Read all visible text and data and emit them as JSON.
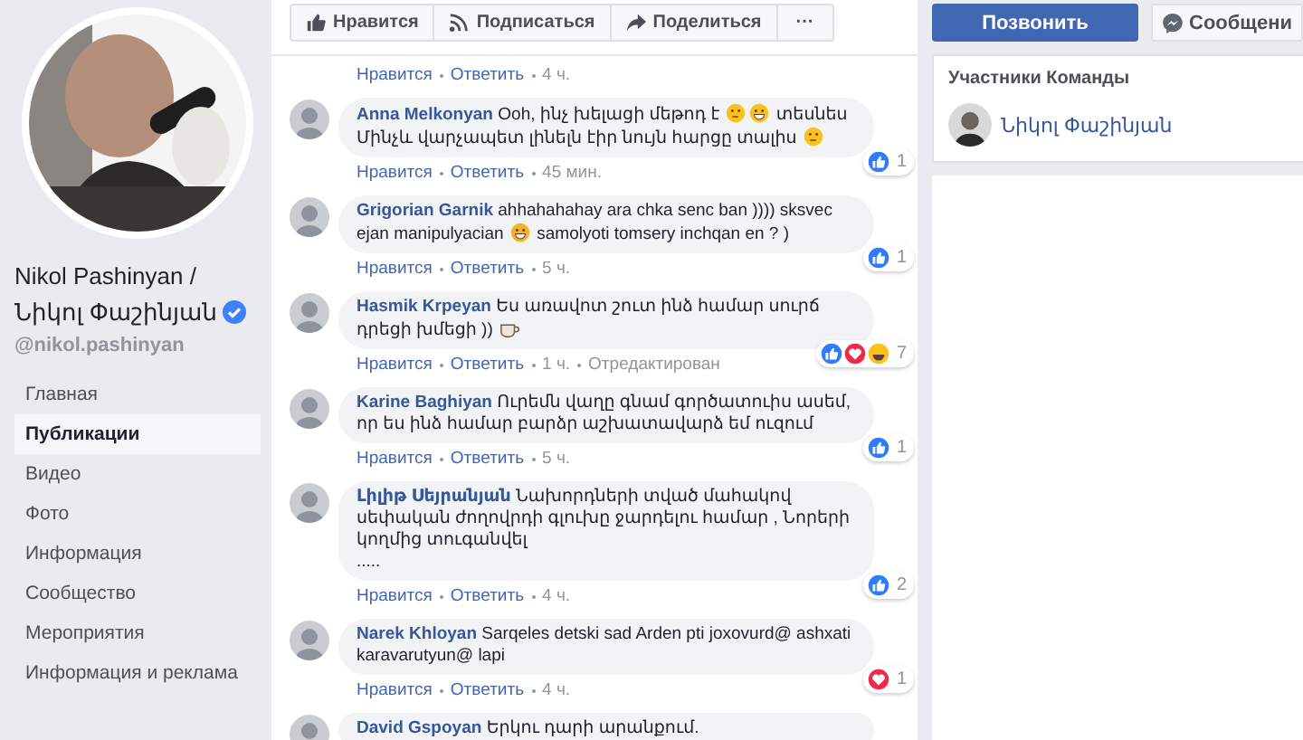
{
  "profile": {
    "name": "Nikol Pashinyan / Նիկոլ Փաշինյան",
    "verified": true,
    "handle": "@nikol.pashinyan"
  },
  "nav": [
    {
      "label": "Главная",
      "selected": false
    },
    {
      "label": "Публикации",
      "selected": true
    },
    {
      "label": "Видео",
      "selected": false
    },
    {
      "label": "Фото",
      "selected": false
    },
    {
      "label": "Информация",
      "selected": false
    },
    {
      "label": "Сообщество",
      "selected": false
    },
    {
      "label": "Мероприятия",
      "selected": false
    },
    {
      "label": "Информация и реклама",
      "selected": false
    }
  ],
  "actions": [
    {
      "kind": "like",
      "label": "Нравится"
    },
    {
      "kind": "follow",
      "label": "Подписаться"
    },
    {
      "kind": "share",
      "label": "Поделиться"
    },
    {
      "kind": "more",
      "label": "···"
    }
  ],
  "previous_meta": {
    "like": "Нравится",
    "reply": "Ответить",
    "time": "4 ч."
  },
  "comments": [
    {
      "author": "Anna Melkonyan",
      "parts": [
        {
          "kind": "text",
          "text": "Ooh, ինչ խելացի մեթոդ է "
        },
        {
          "kind": "thinking"
        },
        {
          "kind": "grin"
        },
        {
          "kind": "text",
          "text": " տեսնես Մինչև վարչապետ լինելն էիր նույն հարցը տալիս "
        },
        {
          "kind": "thinking"
        }
      ],
      "reactions": [
        {
          "kind": "like"
        }
      ],
      "count": "1",
      "meta": {
        "like": "Нравится",
        "reply": "Ответить",
        "time": "45 мин."
      }
    },
    {
      "author": "Grigorian Garnik",
      "parts": [
        {
          "kind": "text",
          "text": "ahhahahahay ara chka senc ban )))) sksvec ejan manipulyacian "
        },
        {
          "kind": "laugh"
        },
        {
          "kind": "text",
          "text": " samolyoti tomsery inchqan en ? )"
        }
      ],
      "reactions": [
        {
          "kind": "like"
        }
      ],
      "count": "1",
      "meta": {
        "like": "Нравится",
        "reply": "Ответить",
        "time": "5 ч."
      }
    },
    {
      "author": "Hasmik Krpeyan",
      "parts": [
        {
          "kind": "text",
          "text": "Ես առավոտ շուտ ինձ համար սուրճ դրեցի խմեցի )) "
        },
        {
          "kind": "coffee"
        }
      ],
      "reactions": [
        {
          "kind": "like"
        },
        {
          "kind": "love"
        },
        {
          "kind": "haha"
        }
      ],
      "count": "7",
      "meta": {
        "like": "Нравится",
        "reply": "Ответить",
        "time": "1 ч.",
        "edited": "Отредактирован"
      }
    },
    {
      "author": "Karine Baghiyan",
      "parts": [
        {
          "kind": "text",
          "text": "Ուրեմն վաղը գնամ գործատուիս ասեմ, որ ես ինձ համար բարձր աշխատավարձ եմ ուզում"
        }
      ],
      "reactions": [
        {
          "kind": "like"
        }
      ],
      "count": "1",
      "meta": {
        "like": "Нравится",
        "reply": "Ответить",
        "time": "5 ч."
      }
    },
    {
      "author": "Լիլիթ Սեյրանյան",
      "parts": [
        {
          "kind": "text",
          "text": "Նախորդների տված մահակով սեփական ժողովրդի գլուխը ջարդելու համար , Նորերի կողմից տուգանվել\n....."
        }
      ],
      "reactions": [
        {
          "kind": "like"
        }
      ],
      "count": "2",
      "meta": {
        "like": "Нравится",
        "reply": "Ответить",
        "time": "4 ч."
      }
    },
    {
      "author": "Narek Khloyan",
      "parts": [
        {
          "kind": "text",
          "text": "Sarqeles detski sad Arden pti joxovurd@ ashxati karavarutyun@ lapi"
        }
      ],
      "reactions": [
        {
          "kind": "love"
        }
      ],
      "count": "1",
      "meta": {
        "like": "Нравится",
        "reply": "Ответить",
        "time": "4 ч."
      }
    },
    {
      "author": "David Gspoyan",
      "parts": [
        {
          "kind": "text",
          "text": "Երկու դարի արանքում."
        }
      ]
    }
  ],
  "right": {
    "call": "Позвонить",
    "message": "Сообщени",
    "team_title": "Участники Команды",
    "member": "Նիկոլ Փաշինյան"
  }
}
